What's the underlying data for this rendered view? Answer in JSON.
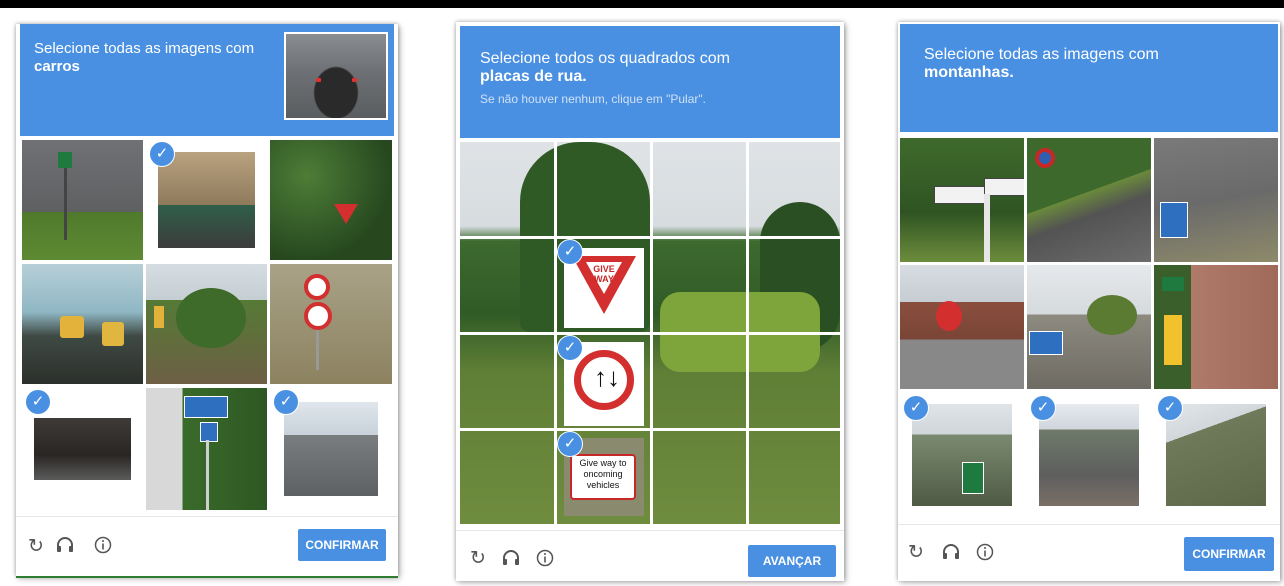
{
  "widget1": {
    "prompt_line1": "Selecione todas as imagens com",
    "prompt_line2": "carros",
    "button_label": "CONFIRMAR"
  },
  "widget2": {
    "prompt_line1": "Selecione todos os quadrados com",
    "prompt_line2": "placas de rua.",
    "subtext": "Se não houver nenhum, clique em \"Pular\".",
    "button_label": "AVANÇAR",
    "sign_give_way": "GIVE\nWAY",
    "sign_give_way_oncoming": "Give way to oncoming vehicles"
  },
  "widget3": {
    "prompt_line1": "Selecione todas as imagens com",
    "prompt_line2": "montanhas.",
    "button_label": "CONFIRMAR"
  },
  "icons": {
    "reload": "reload-icon",
    "audio": "headphones-icon",
    "info": "info-icon",
    "check": "checkmark-icon"
  },
  "colors": {
    "header_blue": "#4a90e2",
    "check_blue": "#4a90e2",
    "button_blue": "#4a90e2"
  },
  "selected": {
    "widget1": [
      2,
      7,
      9
    ],
    "widget2_cells": [
      5,
      9,
      13
    ],
    "widget3": [
      7,
      8,
      9
    ]
  }
}
